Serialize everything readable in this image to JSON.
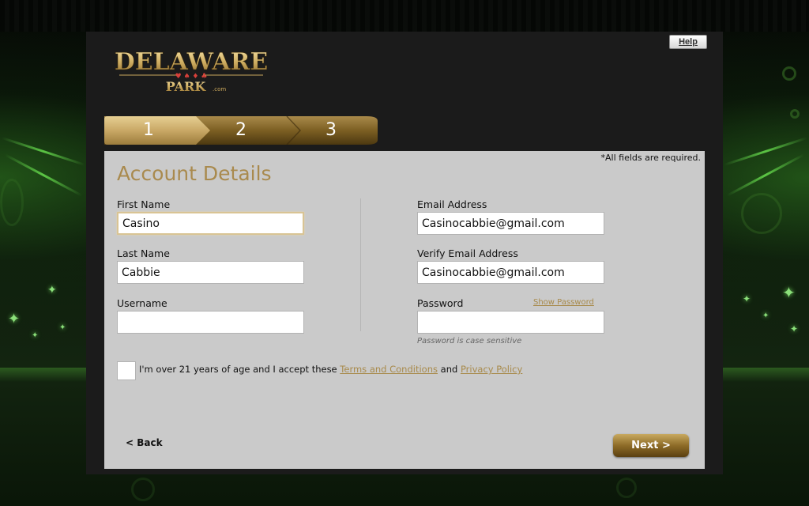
{
  "header": {
    "logo_line1": "DELAWARE",
    "logo_line2": "PARK",
    "logo_suffix": ".com",
    "help_label": "Help"
  },
  "steps": [
    {
      "label": "1",
      "state": "active"
    },
    {
      "label": "2",
      "state": "inactive"
    },
    {
      "label": "3",
      "state": "inactive"
    }
  ],
  "form": {
    "required_note": "*All fields are required.",
    "title": "Account Details",
    "first_name": {
      "label": "First Name",
      "value": "Casino"
    },
    "last_name": {
      "label": "Last Name",
      "value": "Cabbie"
    },
    "username": {
      "label": "Username",
      "value": ""
    },
    "email": {
      "label": "Email Address",
      "value": "Casinocabbie@gmail.com"
    },
    "verify_email": {
      "label": "Verify Email Address",
      "value": "Casinocabbie@gmail.com"
    },
    "password": {
      "label": "Password",
      "value": "",
      "show_label": "Show Password",
      "hint": "Password is case sensitive"
    },
    "terms": {
      "prefix": "I'm over 21 years of age and I accept these",
      "terms_link": "Terms and Conditions",
      "and": "and",
      "privacy_link": "Privacy Policy",
      "checked": false
    },
    "back_label": "< Back",
    "next_label": "Next >"
  },
  "colors": {
    "accent_gold": "#a98a4e",
    "form_bg": "#cacaca",
    "panel_bg": "#1b1b1b"
  }
}
